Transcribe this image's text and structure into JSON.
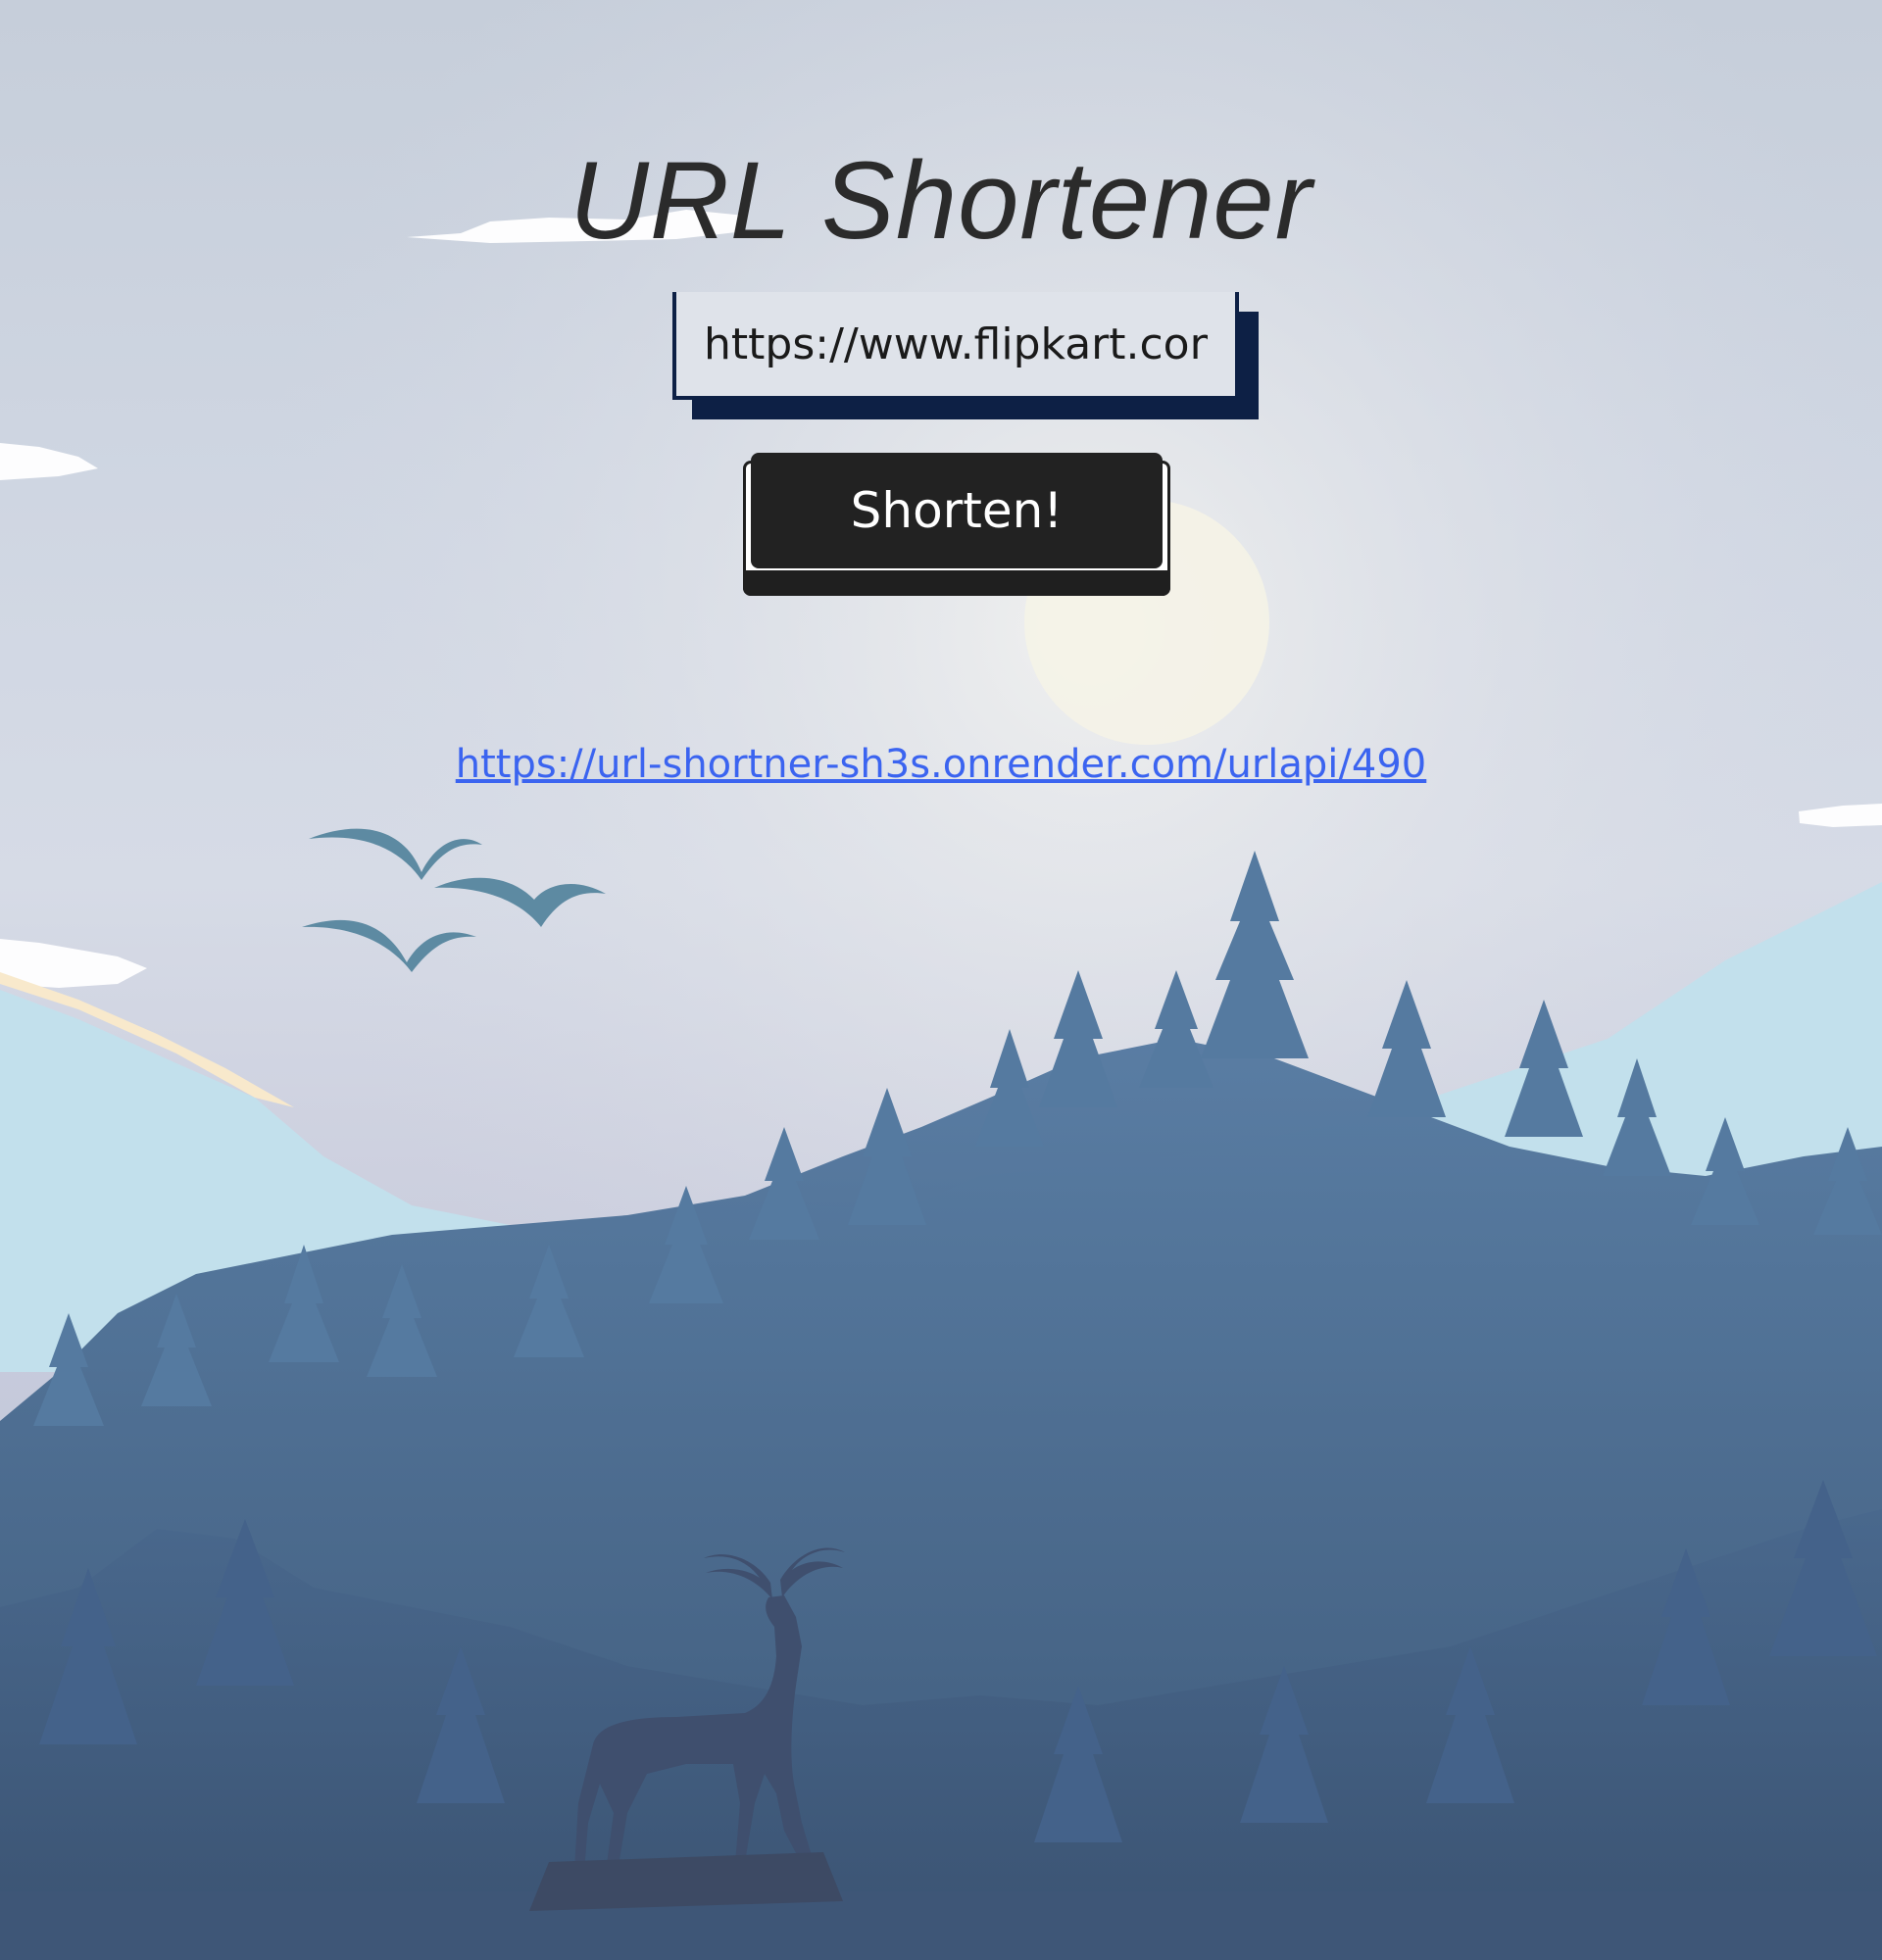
{
  "header": {
    "title": "URL Shortener"
  },
  "form": {
    "url_input_value": "https://www.flipkart.com/",
    "submit_label": "Shorten!"
  },
  "result": {
    "short_url": "https://url-shortner-sh3s.onrender.com/urlapi/490"
  },
  "colors": {
    "title_text": "#2b2b2b",
    "input_border": "#0d2045",
    "button_bg": "#222222",
    "link": "#3b64f0",
    "forest": "#4e6f96"
  },
  "background": {
    "icon_names": [
      "sun-icon",
      "cloud-icon",
      "bird-icon",
      "pine-tree-icon",
      "deer-icon",
      "mountain-icon"
    ]
  }
}
